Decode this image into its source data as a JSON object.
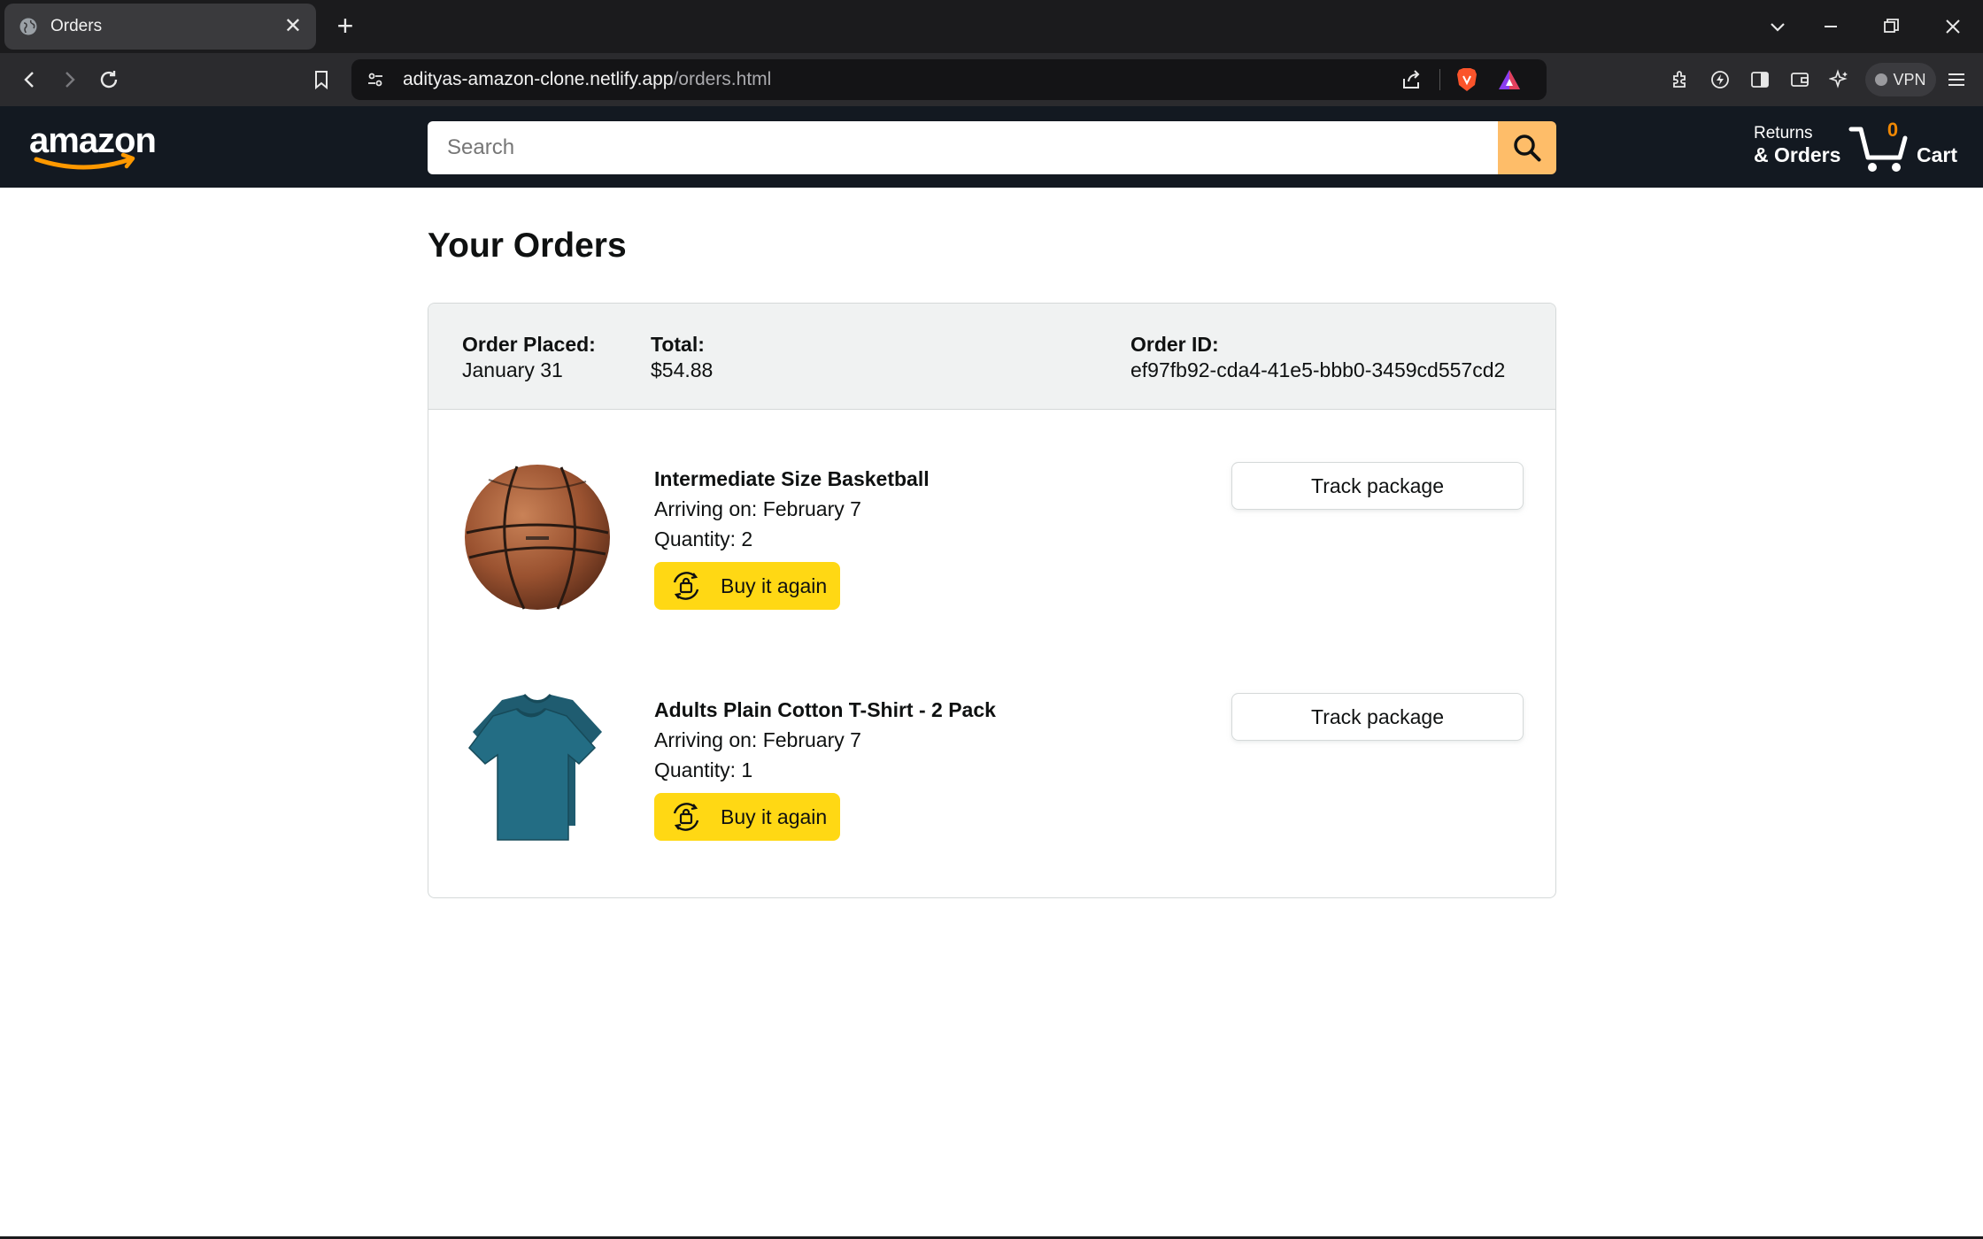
{
  "browser": {
    "tab_title": "Orders",
    "url_host": "adityas-amazon-clone.netlify.app",
    "url_path": "/orders.html",
    "vpn_label": "VPN"
  },
  "header": {
    "logo_text": "amazon",
    "search_placeholder": "Search",
    "returns_line1": "Returns",
    "returns_line2": "& Orders",
    "cart_count": "0",
    "cart_label": "Cart",
    "colors": {
      "header_bg": "#131921",
      "search_button": "#febd69",
      "cart_count": "#f08804"
    }
  },
  "page": {
    "title": "Your Orders"
  },
  "order": {
    "placed_label": "Order Placed:",
    "placed_value": "January 31",
    "total_label": "Total:",
    "total_value": "$54.88",
    "id_label": "Order ID:",
    "id_value": "ef97fb92-cda4-41e5-bbb0-3459cd557cd2",
    "items": [
      {
        "name": "Intermediate Size Basketball",
        "arriving": "Arriving on: February 7",
        "quantity": "Quantity: 2",
        "buy_again": "Buy it again",
        "track": "Track package",
        "image": "basketball"
      },
      {
        "name": "Adults Plain Cotton T-Shirt - 2 Pack",
        "arriving": "Arriving on: February 7",
        "quantity": "Quantity: 1",
        "buy_again": "Buy it again",
        "track": "Track package",
        "image": "teal-t-shirts"
      }
    ]
  }
}
